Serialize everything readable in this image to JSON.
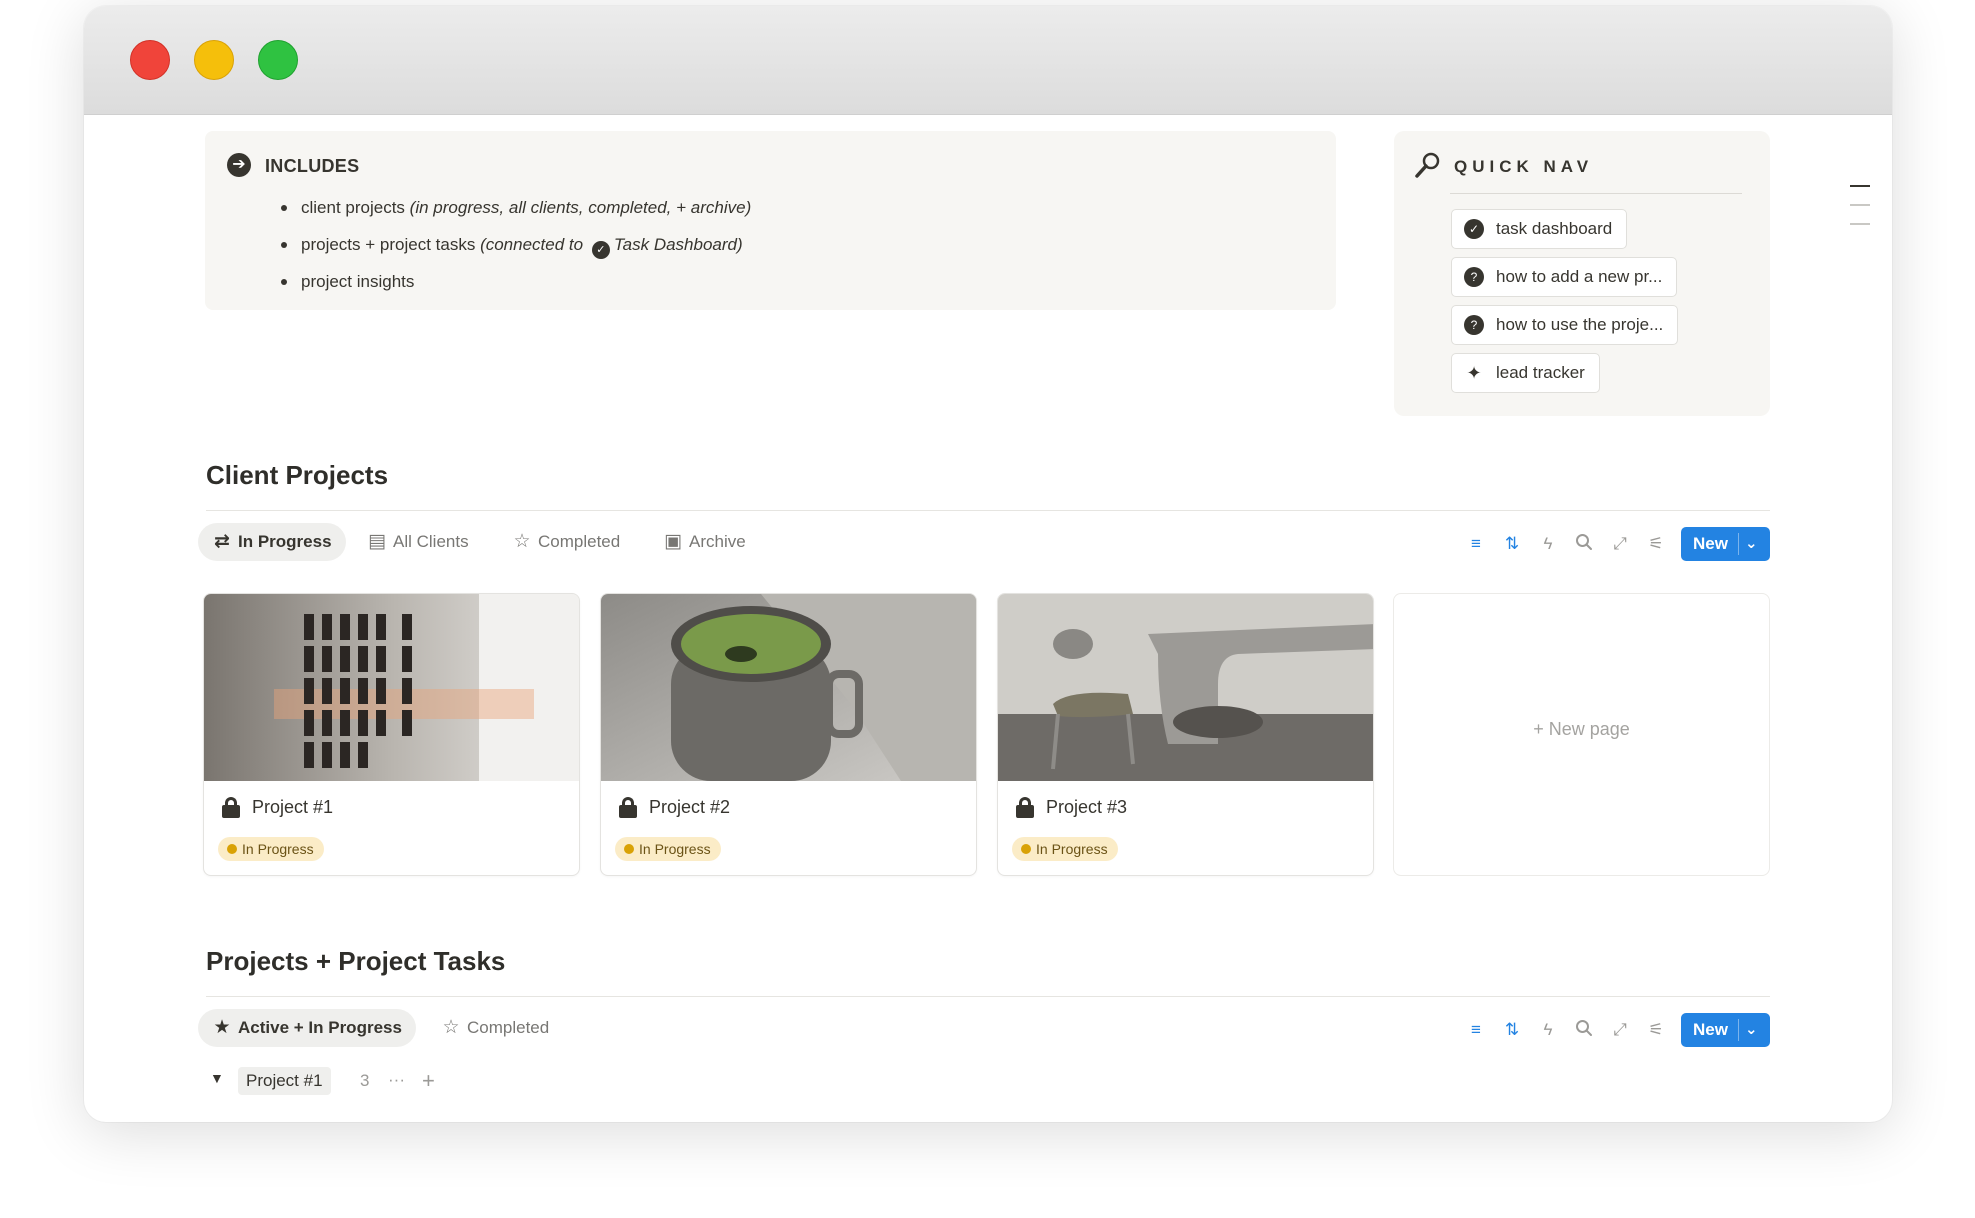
{
  "window": {
    "controls": [
      "close",
      "minimize",
      "zoom"
    ]
  },
  "includes": {
    "title": "INCLUDES",
    "items": [
      {
        "text": "client projects ",
        "note": "(in progress, all clients, completed, + archive)"
      },
      {
        "text": "projects + project tasks ",
        "note_prefix": "(connected to ",
        "link": "Task Dashboard",
        "note_suffix": ")"
      },
      {
        "text": "project insights"
      }
    ]
  },
  "quick_nav": {
    "title": "QUICK NAV",
    "links": [
      {
        "label": "task dashboard",
        "icon": "check-circle-icon"
      },
      {
        "label": "how to add a new pr...",
        "icon": "speech-bubble-icon"
      },
      {
        "label": "how to use the proje...",
        "icon": "speech-bubble-icon"
      },
      {
        "label": "lead tracker",
        "icon": "sparkle-icon"
      }
    ]
  },
  "client_projects": {
    "title": "Client Projects",
    "tabs": [
      {
        "label": "In Progress",
        "icon": "sync-icon",
        "active": true
      },
      {
        "label": "All Clients",
        "icon": "cabinet-icon",
        "active": false
      },
      {
        "label": "Completed",
        "icon": "star-outline-icon",
        "active": false
      },
      {
        "label": "Archive",
        "icon": "archive-box-icon",
        "active": false
      }
    ],
    "new_label": "New",
    "cards": [
      {
        "name": "Project #1",
        "status": "In Progress"
      },
      {
        "name": "Project #2",
        "status": "In Progress"
      },
      {
        "name": "Project #3",
        "status": "In Progress"
      }
    ],
    "new_page_label": "+   New page"
  },
  "project_tasks": {
    "title": "Projects + Project Tasks",
    "tabs": [
      {
        "label": "Active + In Progress",
        "icon": "star-filled-icon",
        "active": true
      },
      {
        "label": "Completed",
        "icon": "star-outline-icon",
        "active": false
      }
    ],
    "new_label": "New",
    "group": {
      "name": "Project #1",
      "count": "3"
    }
  },
  "colors": {
    "accent": "#2383e2",
    "status_bg": "#fbecc7",
    "status_dot": "#d9a206",
    "callout_bg": "#f7f6f3"
  }
}
